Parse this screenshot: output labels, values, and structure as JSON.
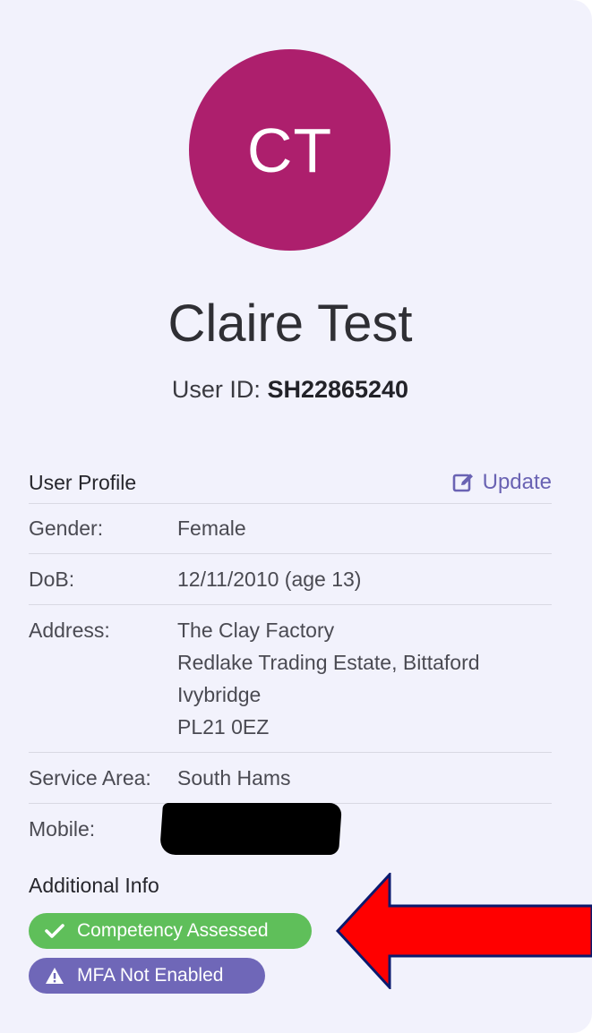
{
  "profile": {
    "initials": "CT",
    "name": "Claire Test",
    "user_id_label": "User ID:",
    "user_id_value": "SH22865240"
  },
  "user_profile": {
    "title": "User Profile",
    "update_label": "Update",
    "update_icon": "edit-icon",
    "rows": [
      {
        "label": "Gender:",
        "lines": [
          "Female"
        ]
      },
      {
        "label": "DoB:",
        "lines": [
          "12/11/2010 (age 13)"
        ]
      },
      {
        "label": "Address:",
        "lines": [
          "The Clay Factory",
          "Redlake Trading Estate, Bittaford",
          "Ivybridge",
          "PL21 0EZ"
        ]
      },
      {
        "label": "Service Area:",
        "lines": [
          "South Hams"
        ]
      },
      {
        "label": "Mobile:",
        "lines": [
          ""
        ]
      }
    ]
  },
  "additional_info": {
    "title": "Additional Info",
    "badges": [
      {
        "label": "Competency Assessed",
        "icon": "check-icon",
        "color": "#5fbf5a"
      },
      {
        "label": "MFA Not Enabled",
        "icon": "warning-icon",
        "color": "#6f67b8"
      }
    ]
  },
  "colors": {
    "avatar": "#ad1f6d",
    "accent": "#6a63b3",
    "card_background": "#f2f2fc",
    "annotation_arrow": "#ff0000"
  }
}
